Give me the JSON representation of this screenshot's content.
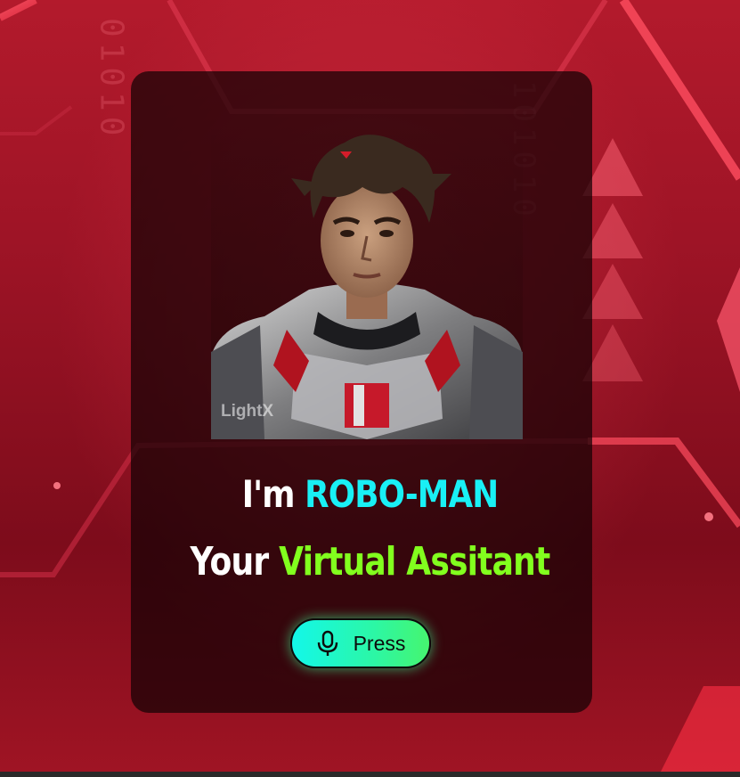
{
  "hero": {
    "greeting_prefix": "I'm",
    "name": "ROBO-MAN",
    "tagline_prefix": "Your",
    "tagline_highlight": "Virtual Assitant"
  },
  "portrait": {
    "watermark": "LightX"
  },
  "action": {
    "button_label": "Press",
    "icon": "microphone-icon"
  },
  "background": {
    "binary_left": "01010",
    "binary_right": "101010"
  },
  "colors": {
    "name_accent": "#19f0f5",
    "tagline_accent": "#82ff1e",
    "button_gradient_start": "#13f7e9",
    "button_gradient_end": "#46f56f"
  }
}
